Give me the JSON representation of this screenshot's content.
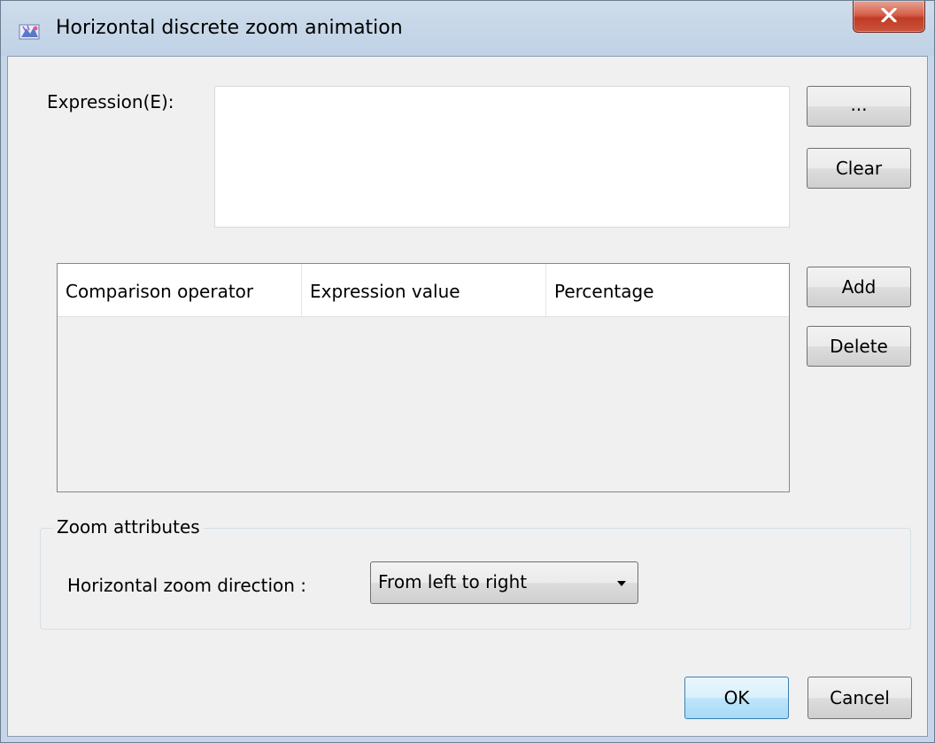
{
  "window": {
    "title": "Horizontal discrete zoom animation"
  },
  "expression": {
    "label": "Expression(E):",
    "value": "",
    "browse_label": "...",
    "clear_label": "Clear"
  },
  "table": {
    "columns": [
      "Comparison operator",
      "Expression value",
      "Percentage"
    ],
    "rows": [],
    "add_label": "Add",
    "delete_label": "Delete"
  },
  "zoom_attributes": {
    "group_title": "Zoom attributes",
    "direction_label": "Horizontal zoom direction :",
    "direction_value": "From left to right"
  },
  "footer": {
    "ok_label": "OK",
    "cancel_label": "Cancel"
  },
  "colors": {
    "close_button": "#c9543c",
    "ok_border": "#3c7fb1",
    "dialog_background": "#f0f0f0"
  }
}
